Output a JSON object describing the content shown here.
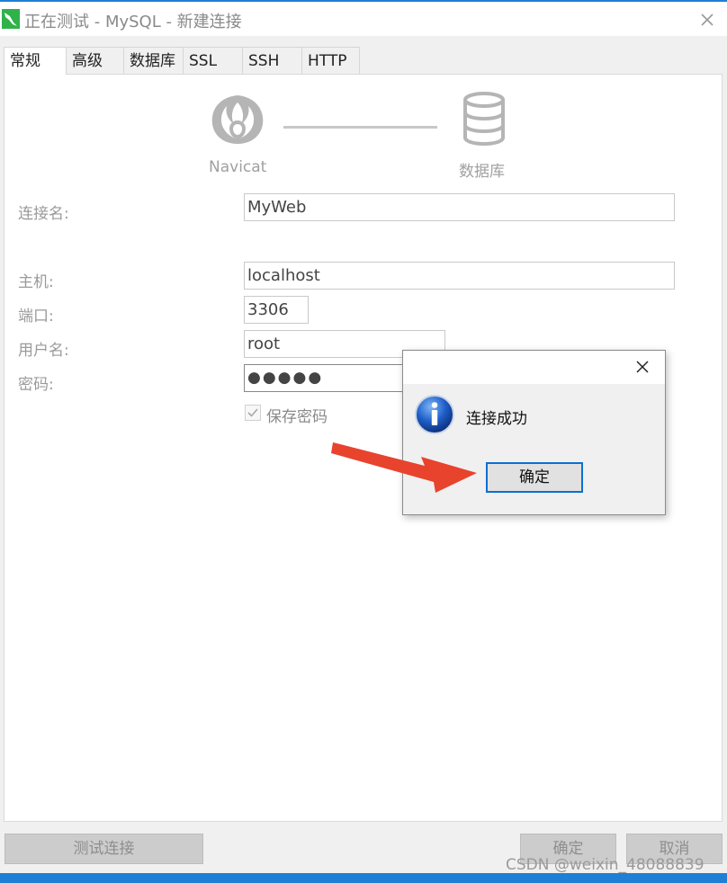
{
  "window": {
    "title": "正在测试 - MySQL - 新建连接",
    "icon": "navicat-mysql-icon",
    "accent_color": "#1e7fd4"
  },
  "tabs": [
    {
      "label": "常规",
      "active": true
    },
    {
      "label": "高级",
      "active": false
    },
    {
      "label": "数据库",
      "active": false
    },
    {
      "label": "SSL",
      "active": false
    },
    {
      "label": "SSH",
      "active": false
    },
    {
      "label": "HTTP",
      "active": false
    }
  ],
  "diagram": {
    "left_caption": "Navicat",
    "right_caption": "数据库"
  },
  "form": {
    "connection_name": {
      "label": "连接名:",
      "value": "MyWeb"
    },
    "host": {
      "label": "主机:",
      "value": "localhost"
    },
    "port": {
      "label": "端口:",
      "value": "3306"
    },
    "username": {
      "label": "用户名:",
      "value": "root"
    },
    "password": {
      "label": "密码:",
      "value": "●●●●●"
    },
    "save_password": {
      "label": "保存密码",
      "checked": true
    }
  },
  "footer": {
    "test_button": "测试连接",
    "ok_button": "确定",
    "cancel_button": "取消"
  },
  "dialog": {
    "message": "连接成功",
    "ok_button": "确定",
    "icon": "info-icon"
  },
  "annotation": {
    "arrow_color": "#e8432d"
  },
  "watermark": "CSDN @weixin_48088839"
}
